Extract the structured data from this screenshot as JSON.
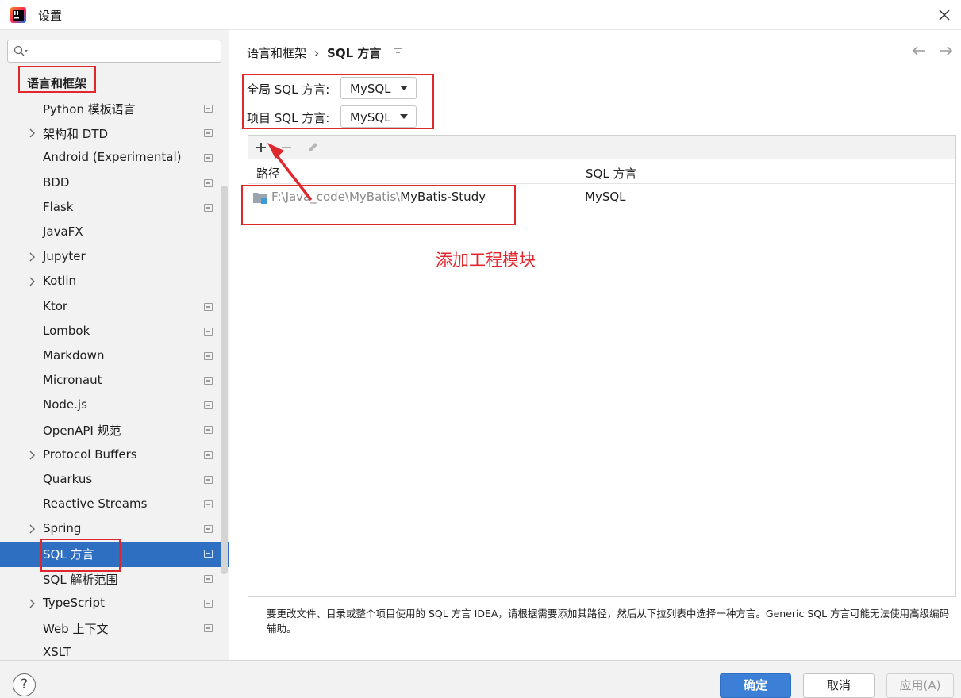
{
  "window": {
    "title": "设置",
    "close_icon": "close-icon",
    "app_icon": "intellij-idea-icon"
  },
  "sidebar": {
    "search": {
      "value": "",
      "placeholder": ""
    },
    "section_title": "语言和框架",
    "selected_index": 17,
    "items": [
      {
        "label": "Python 模板语言",
        "expandable": false
      },
      {
        "label": "架构和 DTD",
        "expandable": true
      },
      {
        "label": "Android (Experimental)",
        "expandable": false
      },
      {
        "label": "BDD",
        "expandable": false
      },
      {
        "label": "Flask",
        "expandable": false
      },
      {
        "label": "JavaFX",
        "expandable": false
      },
      {
        "label": "Jupyter",
        "expandable": true
      },
      {
        "label": "Kotlin",
        "expandable": true
      },
      {
        "label": "Ktor",
        "expandable": false
      },
      {
        "label": "Lombok",
        "expandable": false
      },
      {
        "label": "Markdown",
        "expandable": false
      },
      {
        "label": "Micronaut",
        "expandable": false
      },
      {
        "label": "Node.js",
        "expandable": false
      },
      {
        "label": "OpenAPI 规范",
        "expandable": false
      },
      {
        "label": "Protocol Buffers",
        "expandable": true
      },
      {
        "label": "Quarkus",
        "expandable": false
      },
      {
        "label": "Reactive Streams",
        "expandable": false
      },
      {
        "label": "Spring",
        "expandable": true
      },
      {
        "label": "SQL 方言",
        "expandable": false
      },
      {
        "label": "SQL 解析范围",
        "expandable": false
      },
      {
        "label": "TypeScript",
        "expandable": true
      },
      {
        "label": "Web 上下文",
        "expandable": false
      },
      {
        "label": "XSLT",
        "expandable": false
      }
    ]
  },
  "main": {
    "breadcrumb": {
      "parent": "语言和框架",
      "separator": "›",
      "current": "SQL 方言"
    },
    "global_dialect": {
      "label": "全局 SQL 方言:",
      "value": "MySQL"
    },
    "project_dialect": {
      "label": "项目 SQL 方言:",
      "value": "MySQL"
    },
    "table": {
      "toolbar": {
        "add": "+",
        "remove": "−",
        "edit_icon": "pencil-icon"
      },
      "columns": [
        "路径",
        "SQL 方言"
      ],
      "rows": [
        {
          "path_prefix": "F:\\Java_code\\MyBatis\\",
          "path_name": "MyBatis-Study",
          "dialect": "MySQL"
        }
      ]
    },
    "hint": "要更改文件、目录或整个项目使用的 SQL 方言 IDEA，请根据需要添加其路径，然后从下拉列表中选择一种方言。Generic SQL 方言可能无法使用高级编码辅助。",
    "annotation": "添加工程模块"
  },
  "footer": {
    "ok": "确定",
    "cancel": "取消",
    "apply": "应用(A)",
    "help": "?"
  },
  "colors": {
    "accent": "#2f6fc2",
    "annotation": "#e0272e"
  }
}
